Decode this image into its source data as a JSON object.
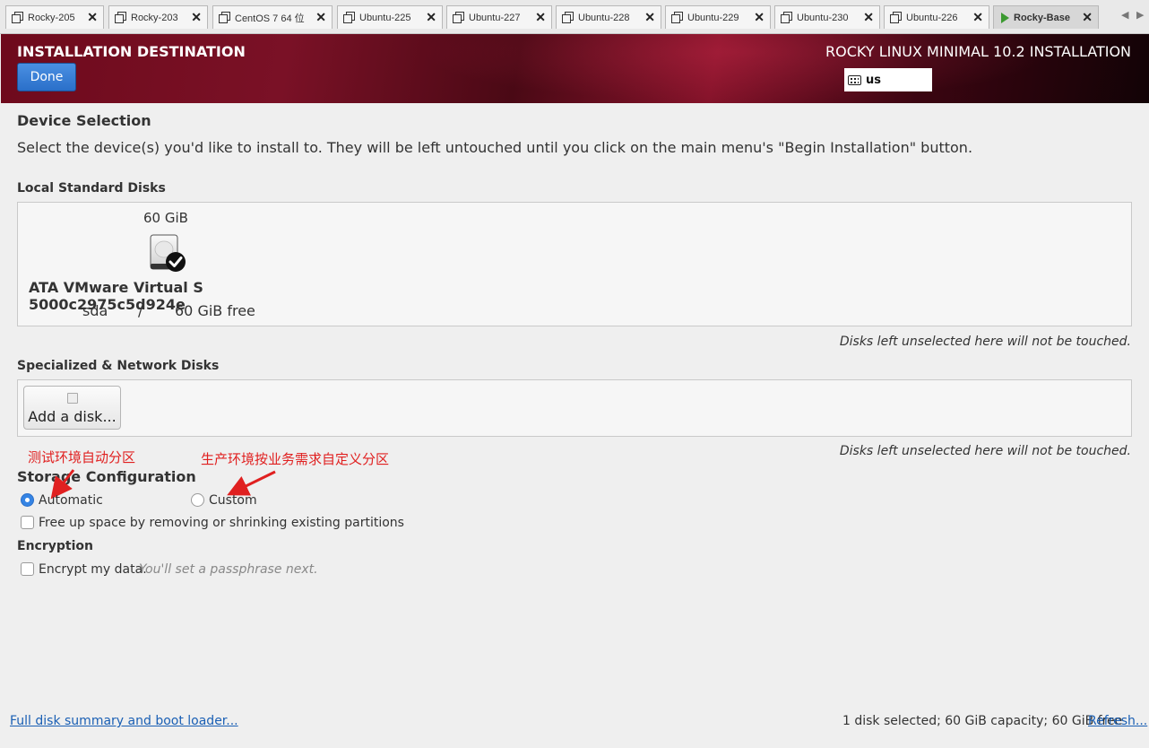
{
  "tabs": [
    {
      "label": "Rocky-205",
      "active": false
    },
    {
      "label": "Rocky-203",
      "active": false
    },
    {
      "label": "CentOS 7 64 位",
      "active": false
    },
    {
      "label": "Ubuntu-225",
      "active": false
    },
    {
      "label": "Ubuntu-227",
      "active": false
    },
    {
      "label": "Ubuntu-228",
      "active": false
    },
    {
      "label": "Ubuntu-229",
      "active": false
    },
    {
      "label": "Ubuntu-230",
      "active": false
    },
    {
      "label": "Ubuntu-226",
      "active": false
    },
    {
      "label": "Rocky-Base",
      "active": true
    }
  ],
  "tab_scroll": {
    "left": "◀",
    "right": "▶"
  },
  "header": {
    "title": "INSTALLATION DESTINATION",
    "product": "ROCKY LINUX MINIMAL 10.2 INSTALLATION",
    "done_label": "Done",
    "keyboard_layout": "us"
  },
  "device_selection": {
    "heading": "Device Selection",
    "description": "Select the device(s) you'd like to install to.  They will be left untouched until you click on the main menu's \"Begin Installation\" button."
  },
  "local_disks": {
    "heading": "Local Standard Disks",
    "disk": {
      "size": "60 GiB",
      "name": "ATA VMware Virtual S 5000c2975c5d924e",
      "device": "sda",
      "separator": "/",
      "free": "60 GiB free",
      "selected": true
    },
    "note": "Disks left unselected here will not be touched."
  },
  "network_disks": {
    "heading": "Specialized & Network Disks",
    "add_disk_label": "Add a disk...",
    "note": "Disks left unselected here will not be touched."
  },
  "annotations": {
    "auto_note": "测试环境自动分区",
    "custom_note": "生产环境按业务需求自定义分区"
  },
  "storage_configuration": {
    "heading": "Storage Configuration",
    "automatic_label": "Automatic",
    "custom_label": "Custom",
    "selected": "Automatic",
    "free_space_label": "Free up space by removing or shrinking existing partitions",
    "free_space_checked": false
  },
  "encryption": {
    "heading": "Encryption",
    "encrypt_label": "Encrypt my data.",
    "encrypt_hint": "You'll set a passphrase next.",
    "encrypt_checked": false
  },
  "footer": {
    "summary_link": "Full disk summary and boot loader...",
    "status": "1 disk selected; 60 GiB capacity; 60 GiB free",
    "refresh_link": "Refresh..."
  },
  "colors": {
    "accent_blue": "#3584e4",
    "annotation_red": "#e02020",
    "header_red": "#7a1126"
  }
}
